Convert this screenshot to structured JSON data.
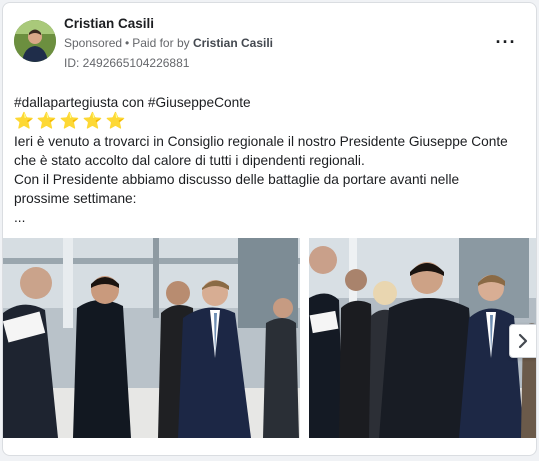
{
  "ad": {
    "page_name": "Cristian Casili",
    "sponsored_label": "Sponsored",
    "separator": "•",
    "paid_for_prefix": "Paid for by",
    "paid_for_name": "Cristian Casili",
    "library_id": "ID: 2492665104226881",
    "more_icon": "more-horizontal-icon",
    "more_glyph": "···"
  },
  "post": {
    "hashtags": "#dallapartegiusta con #GiuseppeConte",
    "stars": [
      "⭐",
      "⭐",
      "⭐",
      "⭐",
      "⭐"
    ],
    "lines": [
      "Ieri è venuto a trovarci in Consiglio regionale il nostro Presidente Giuseppe Conte",
      "che è stato accolto dal calore di tutti i dipendenti regionali.",
      "Con il Presidente abbiamo discusso delle battaglie da portare avanti nelle",
      "prossime settimane:",
      "..."
    ]
  },
  "carousel": {
    "next_icon": "chevron-right-icon",
    "accent": "#f8c33c"
  }
}
